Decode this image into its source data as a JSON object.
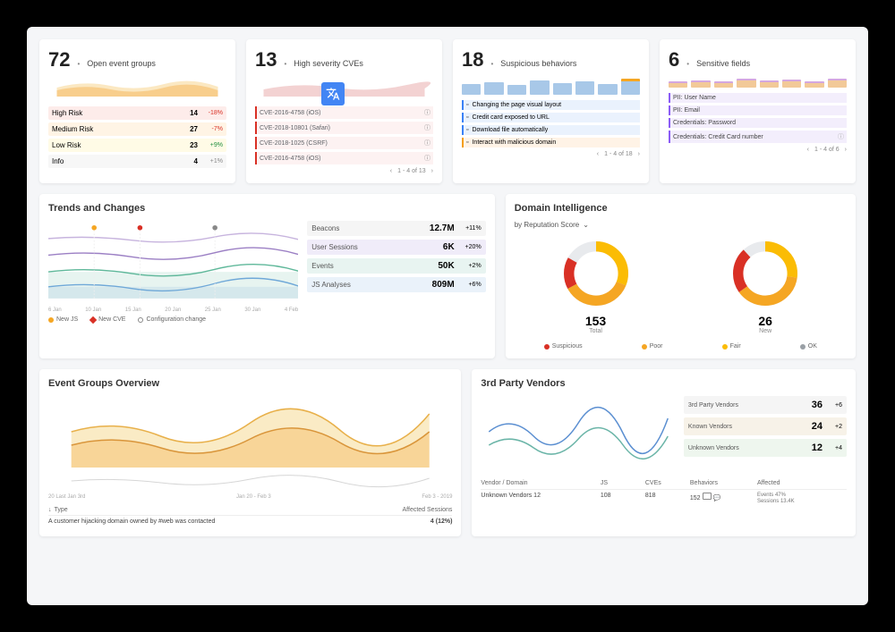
{
  "top_cards": {
    "open_events": {
      "value": "72",
      "label": "Open event groups",
      "risks": [
        {
          "name": "High Risk",
          "value": "14",
          "delta": "-18%",
          "dir": "neg"
        },
        {
          "name": "Medium Risk",
          "value": "27",
          "delta": "-7%",
          "dir": "neg"
        },
        {
          "name": "Low Risk",
          "value": "23",
          "delta": "+9%",
          "dir": "pos"
        },
        {
          "name": "Info",
          "value": "4",
          "delta": "+1%",
          "dir": "muted"
        }
      ]
    },
    "cves": {
      "value": "13",
      "label": "High severity CVEs",
      "items": [
        "CVE-2016-4758 (iOS)",
        "CVE-2018-10801 (Safari)",
        "CVE-2018-1025 (CSRF)",
        "CVE-2016-4758 (iOS)"
      ],
      "paginator": "1 - 4 of 13"
    },
    "behaviors": {
      "value": "18",
      "label": "Suspicious behaviors",
      "items": [
        {
          "text": "Changing the page visual layout",
          "style": "b-blue"
        },
        {
          "text": "Credit card exposed to URL",
          "style": "b-blue"
        },
        {
          "text": "Download file automatically",
          "style": "b-blue"
        },
        {
          "text": "Interact with malicious domain",
          "style": "b-orange"
        }
      ],
      "paginator": "1 - 4 of 18"
    },
    "fields": {
      "value": "6",
      "label": "Sensitive fields",
      "items": [
        "PII: User Name",
        "PII: Email",
        "Credentials: Password",
        "Credentials: Credit Card number"
      ],
      "paginator": "1 - 4 of 6"
    }
  },
  "trends": {
    "title": "Trends and Changes",
    "x_labels": [
      "6 Jan",
      "10 Jan",
      "15 Jan",
      "20 Jan",
      "25 Jan",
      "30 Jan",
      "4 Feb"
    ],
    "metrics": [
      {
        "label": "Beacons",
        "value": "12.7M",
        "delta": "+11%",
        "cls": "m-gray",
        "dir": "pos"
      },
      {
        "label": "User Sessions",
        "value": "6K",
        "delta": "+20%",
        "cls": "m-purple",
        "dir": "pos"
      },
      {
        "label": "Events",
        "value": "50K",
        "delta": "+2%",
        "cls": "m-teal",
        "dir": "pos"
      },
      {
        "label": "JS Analyses",
        "value": "809M",
        "delta": "+6%",
        "cls": "m-blue",
        "dir": "pos"
      }
    ],
    "legend": [
      {
        "label": "New JS",
        "color": "#f5a623"
      },
      {
        "label": "New CVE",
        "color": "#d93025"
      },
      {
        "label": "Configuration change",
        "color": "#888"
      }
    ]
  },
  "domain_intel": {
    "title": "Domain Intelligence",
    "selector": "by Reputation Score",
    "donuts": [
      {
        "value": "153",
        "label": "Total"
      },
      {
        "value": "26",
        "label": "New"
      }
    ],
    "legend": [
      {
        "label": "Suspicious",
        "color": "#d93025"
      },
      {
        "label": "Poor",
        "color": "#f5a623"
      },
      {
        "label": "Fair",
        "color": "#fbbc04"
      },
      {
        "label": "OK",
        "color": "#9aa0a6"
      }
    ]
  },
  "overview": {
    "title": "Event Groups Overview",
    "dates": [
      "20 Last Jan 3rd",
      "Jan 20 - Feb 3",
      "Feb 3 - 2019"
    ],
    "col_type": "Type",
    "col_sessions": "Affected Sessions",
    "row_text": "A customer hijacking domain owned by #web was contacted",
    "row_val": "4 (12%)"
  },
  "vendors": {
    "title": "3rd Party Vendors",
    "stats": [
      {
        "label": "3rd Party Vendors",
        "value": "36",
        "delta": "+6",
        "cls": "vs-gray",
        "dir": "muted"
      },
      {
        "label": "Known Vendors",
        "value": "24",
        "delta": "+2",
        "cls": "vs-tan",
        "dir": "muted"
      },
      {
        "label": "Unknown Vendors",
        "value": "12",
        "delta": "+4",
        "cls": "vs-green",
        "dir": "pos"
      }
    ],
    "headers": [
      "Vendor / Domain",
      "JS",
      "CVEs",
      "Behaviors",
      "Affected"
    ],
    "row": {
      "vendor": "Unknown Vendors  12",
      "js": "108",
      "cves": "818",
      "behaviors": "152",
      "affected_a": "Events  47%",
      "affected_b": "Sessions  13.4K"
    }
  },
  "chart_data": {
    "top_sparklines": {
      "open_events": {
        "type": "area",
        "series": [
          "orange",
          "yellow"
        ],
        "range": [
          0,
          100
        ]
      },
      "cves": {
        "type": "area",
        "color": "#e68a8a"
      },
      "behaviors": {
        "type": "bar",
        "color": "#7fb3e0",
        "bars": 8
      },
      "fields": {
        "type": "bar",
        "color": "#e0a67f",
        "bars": 8
      }
    },
    "trends": {
      "type": "line",
      "x": [
        "6 Jan",
        "10 Jan",
        "15 Jan",
        "20 Jan",
        "25 Jan",
        "30 Jan",
        "4 Feb"
      ],
      "series": [
        {
          "name": "Beacons",
          "color": "#bba4d6",
          "values": [
            60,
            62,
            65,
            63,
            66,
            68,
            70
          ]
        },
        {
          "name": "User Sessions",
          "color": "#9b7fc4",
          "values": [
            40,
            42,
            41,
            44,
            43,
            45,
            47
          ]
        },
        {
          "name": "Events",
          "color": "#5fb89a",
          "values": [
            28,
            30,
            29,
            32,
            31,
            33,
            34
          ]
        },
        {
          "name": "JS Analyses",
          "color": "#6fa8d8",
          "values": [
            15,
            18,
            16,
            20,
            19,
            22,
            21
          ]
        }
      ],
      "markers": [
        {
          "x_index": 1,
          "color": "#f5a623"
        },
        {
          "x_index": 2,
          "color": "#d93025"
        },
        {
          "x_index": 4,
          "color": "#888"
        }
      ]
    },
    "domain_donuts": [
      {
        "total": 153,
        "segments": [
          {
            "label": "Suspicious",
            "value": 25,
            "color": "#d93025"
          },
          {
            "label": "Poor",
            "value": 55,
            "color": "#f5a623"
          },
          {
            "label": "Fair",
            "value": 48,
            "color": "#fbbc04"
          },
          {
            "label": "OK",
            "value": 25,
            "color": "#e8eaed"
          }
        ]
      },
      {
        "total": 26,
        "segments": [
          {
            "label": "Suspicious",
            "value": 6,
            "color": "#d93025"
          },
          {
            "label": "Poor",
            "value": 10,
            "color": "#f5a623"
          },
          {
            "label": "Fair",
            "value": 7,
            "color": "#fbbc04"
          },
          {
            "label": "OK",
            "value": 3,
            "color": "#e8eaed"
          }
        ]
      }
    ],
    "overview": {
      "type": "area",
      "series": [
        {
          "name": "orange",
          "color": "#f5b455",
          "values": [
            40,
            55,
            42,
            60,
            48,
            65,
            50,
            58
          ]
        },
        {
          "name": "yellow",
          "color": "#f5d78c",
          "values": [
            20,
            30,
            25,
            35,
            28,
            38,
            30,
            34
          ]
        }
      ]
    },
    "vendors": {
      "type": "line",
      "series": [
        {
          "name": "blue",
          "color": "#5b8fd1",
          "values": [
            30,
            50,
            35,
            55,
            40,
            48,
            42,
            52,
            38
          ]
        },
        {
          "name": "teal",
          "color": "#6bb5a8",
          "values": [
            20,
            28,
            22,
            32,
            24,
            30,
            26,
            29,
            23
          ]
        }
      ]
    }
  }
}
